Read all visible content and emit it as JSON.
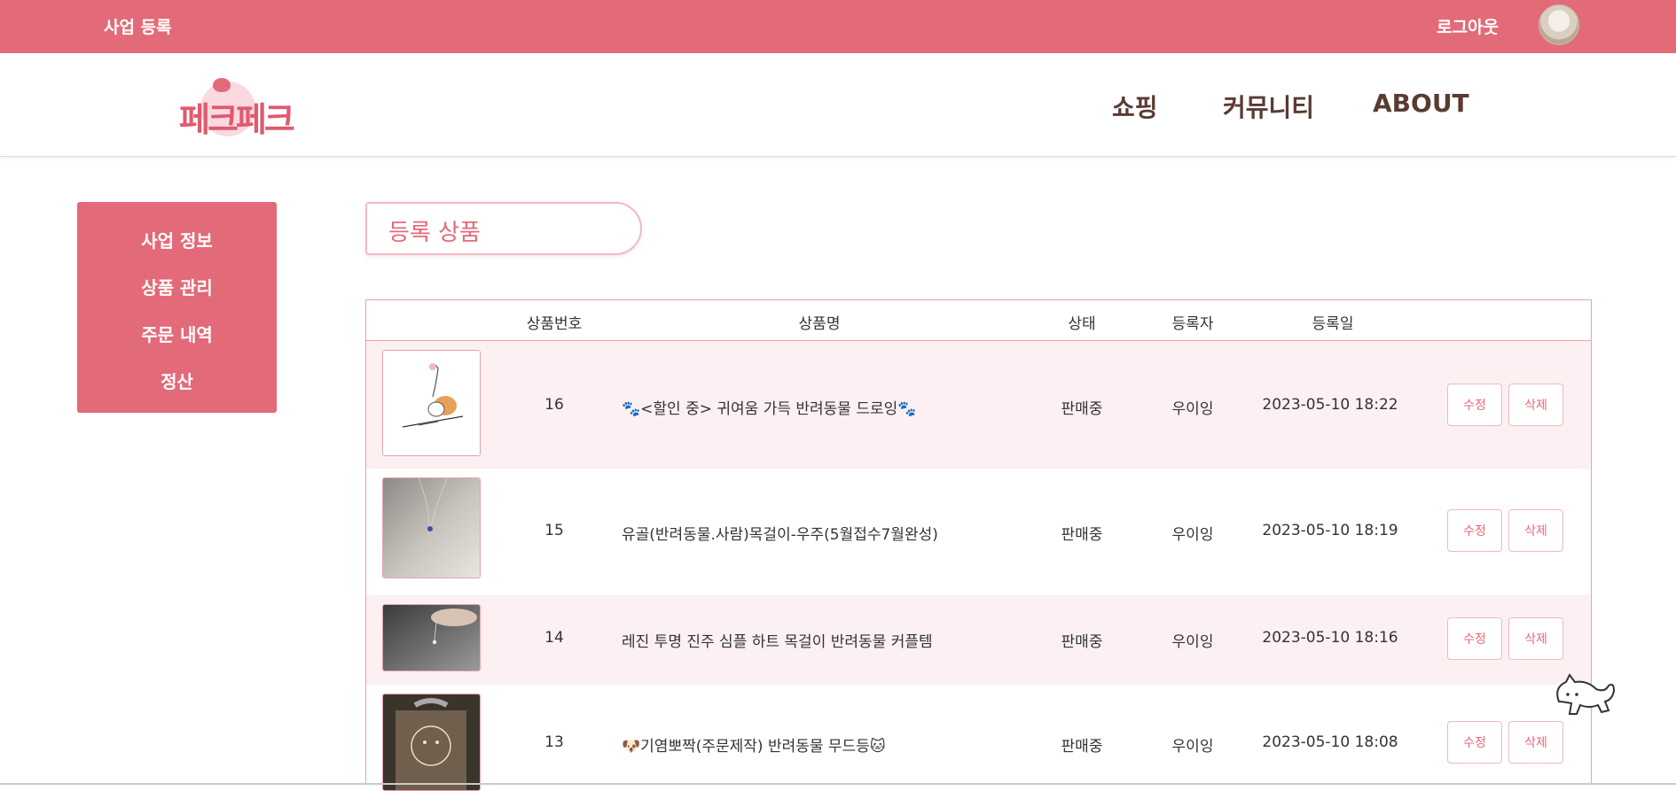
{
  "topbar": {
    "business_register": "사업 등록",
    "logout": "로그아웃"
  },
  "header": {
    "logo_text": "페크페크",
    "nav": [
      "쇼핑",
      "커뮤니티",
      "ABOUT"
    ]
  },
  "sidebar": {
    "items": [
      "사업 정보",
      "상품 관리",
      "주문 내역",
      "정산"
    ]
  },
  "section_title": "등록 상품",
  "table": {
    "headers": [
      "상품번호",
      "상품명",
      "상태",
      "등록자",
      "등록일"
    ],
    "edit_label": "수정",
    "delete_label": "삭제",
    "rows": [
      {
        "id": "16",
        "name": "🐾<할인 중> 귀여움 가득 반려동물 드로잉🐾",
        "status": "판매중",
        "author": "우이잉",
        "date": "2023-05-10 18:22"
      },
      {
        "id": "15",
        "name": "유골(반려동물.사람)목걸이-우주(5월접수7월완성)",
        "status": "판매중",
        "author": "우이잉",
        "date": "2023-05-10 18:19"
      },
      {
        "id": "14",
        "name": "레진 투명 진주 심플 하트 목걸이 반려동물 커플템",
        "status": "판매중",
        "author": "우이잉",
        "date": "2023-05-10 18:16"
      },
      {
        "id": "13",
        "name": "🐶기염뽀짝(주문제작) 반려동물 무드등🐱",
        "status": "판매중",
        "author": "우이잉",
        "date": "2023-05-10 18:08"
      }
    ]
  },
  "colors": {
    "primary": "#e36a79",
    "row_pink": "#fcf0f2",
    "border_pink": "#e8a1ab",
    "nav_brown": "#5a3b32"
  }
}
